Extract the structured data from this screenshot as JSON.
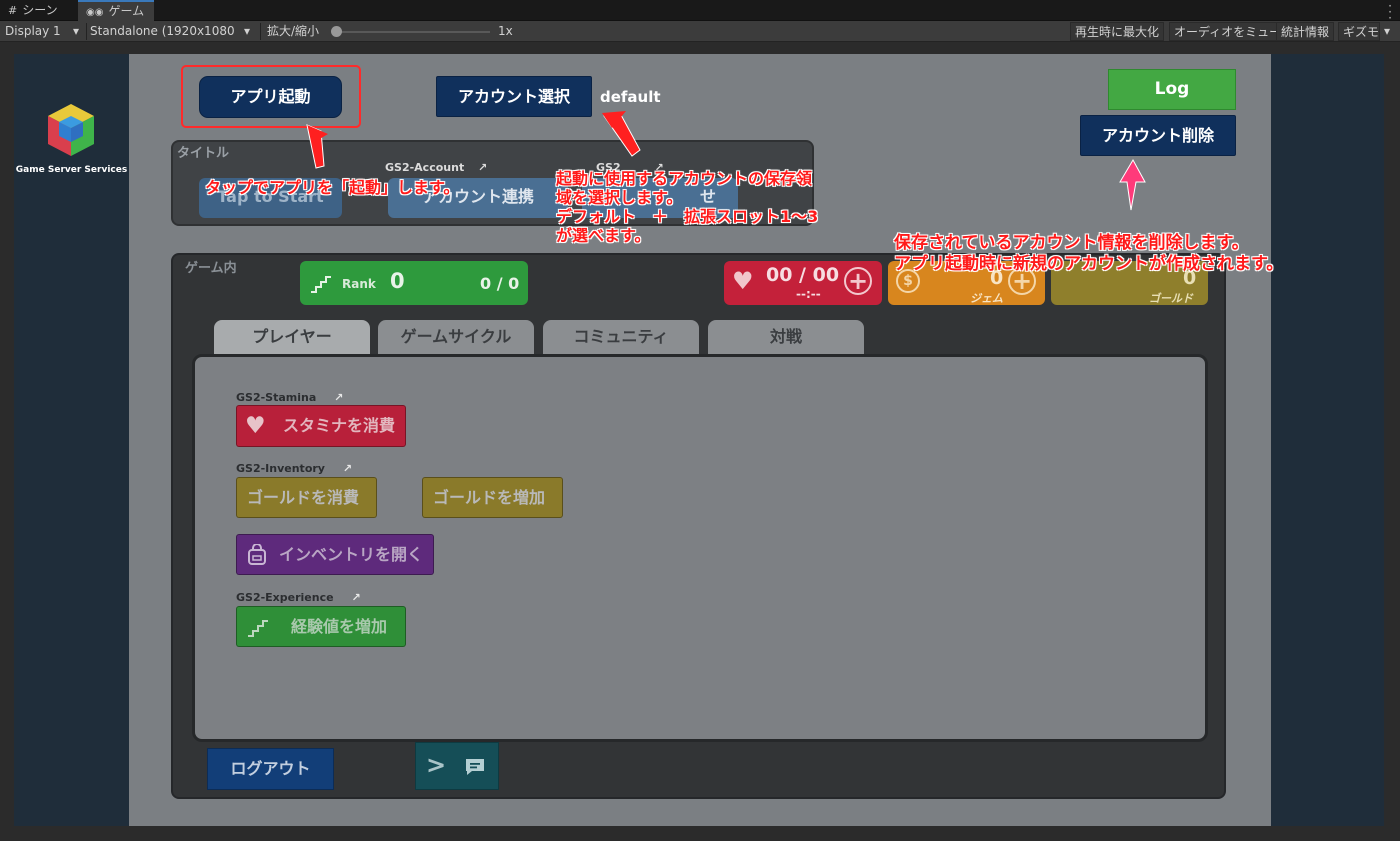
{
  "editor": {
    "tabs": [
      {
        "label": "シーン",
        "icon": "grid-icon"
      },
      {
        "label": "ゲーム",
        "icon": "gamepad-icon"
      }
    ],
    "toolbar": {
      "display": "Display 1",
      "resolution": "Standalone (1920x1080",
      "scale_label": "拡大/縮小",
      "scale_value": "1x",
      "maximize": "再生時に最大化",
      "mute": "オーディオをミュート",
      "stats": "統計情報",
      "gizmos": "ギズモ"
    }
  },
  "logo": {
    "text": "Game Server Services"
  },
  "top_buttons": {
    "launch": "アプリ起動",
    "select_account": "アカウント選択",
    "account_slot": "default",
    "log": "Log",
    "delete_account": "アカウント削除"
  },
  "title_panel": {
    "label": "タイトル",
    "service_label": "GS2-Account",
    "service_label_2": "GS2",
    "start_button": "Tap to Start",
    "link_button": "アカウント連携",
    "third_button": "せ"
  },
  "ingame": {
    "label": "ゲーム内",
    "rank": {
      "label": "Rank",
      "value": "0",
      "progress": "0 / 0"
    },
    "stamina": {
      "value": "00 / 00",
      "timer": "--:--"
    },
    "gem": {
      "value": "0",
      "label": "ジェム"
    },
    "gold": {
      "value": "0",
      "label": "ゴールド"
    },
    "tabs": [
      "プレイヤー",
      "ゲームサイクル",
      "コミュニティ",
      "対戦"
    ],
    "sections": {
      "stamina": "GS2-Stamina",
      "inventory": "GS2-Inventory",
      "experience": "GS2-Experience"
    },
    "buttons": {
      "consume_stamina": "スタミナを消費",
      "consume_gold": "ゴールドを消費",
      "add_gold": "ゴールドを増加",
      "open_inventory": "インベントリを開く",
      "add_exp": "経験値を増加",
      "logout": "ログアウト"
    }
  },
  "annotations": {
    "launch": "タップでアプリを「起動」します。",
    "select": [
      "起動に使用するアカウントの保存領",
      "域を選択します。",
      "デフォルト　＋　拡張スロット1～3",
      "が選べます。"
    ],
    "delete": [
      "保存されているアカウント情報を削除します。",
      "アプリ起動時に新規のアカウントが作成されます。"
    ]
  },
  "colors": {
    "navy": "#10305c",
    "green": "#43a843",
    "annotation_red": "#ff1a1a",
    "stamina_red": "#c4213a",
    "gem_orange": "#e0861e",
    "gold_tan": "#9c8a2e",
    "inventory_purple": "#6a2a8a",
    "exp_green": "#2f9a3a"
  }
}
